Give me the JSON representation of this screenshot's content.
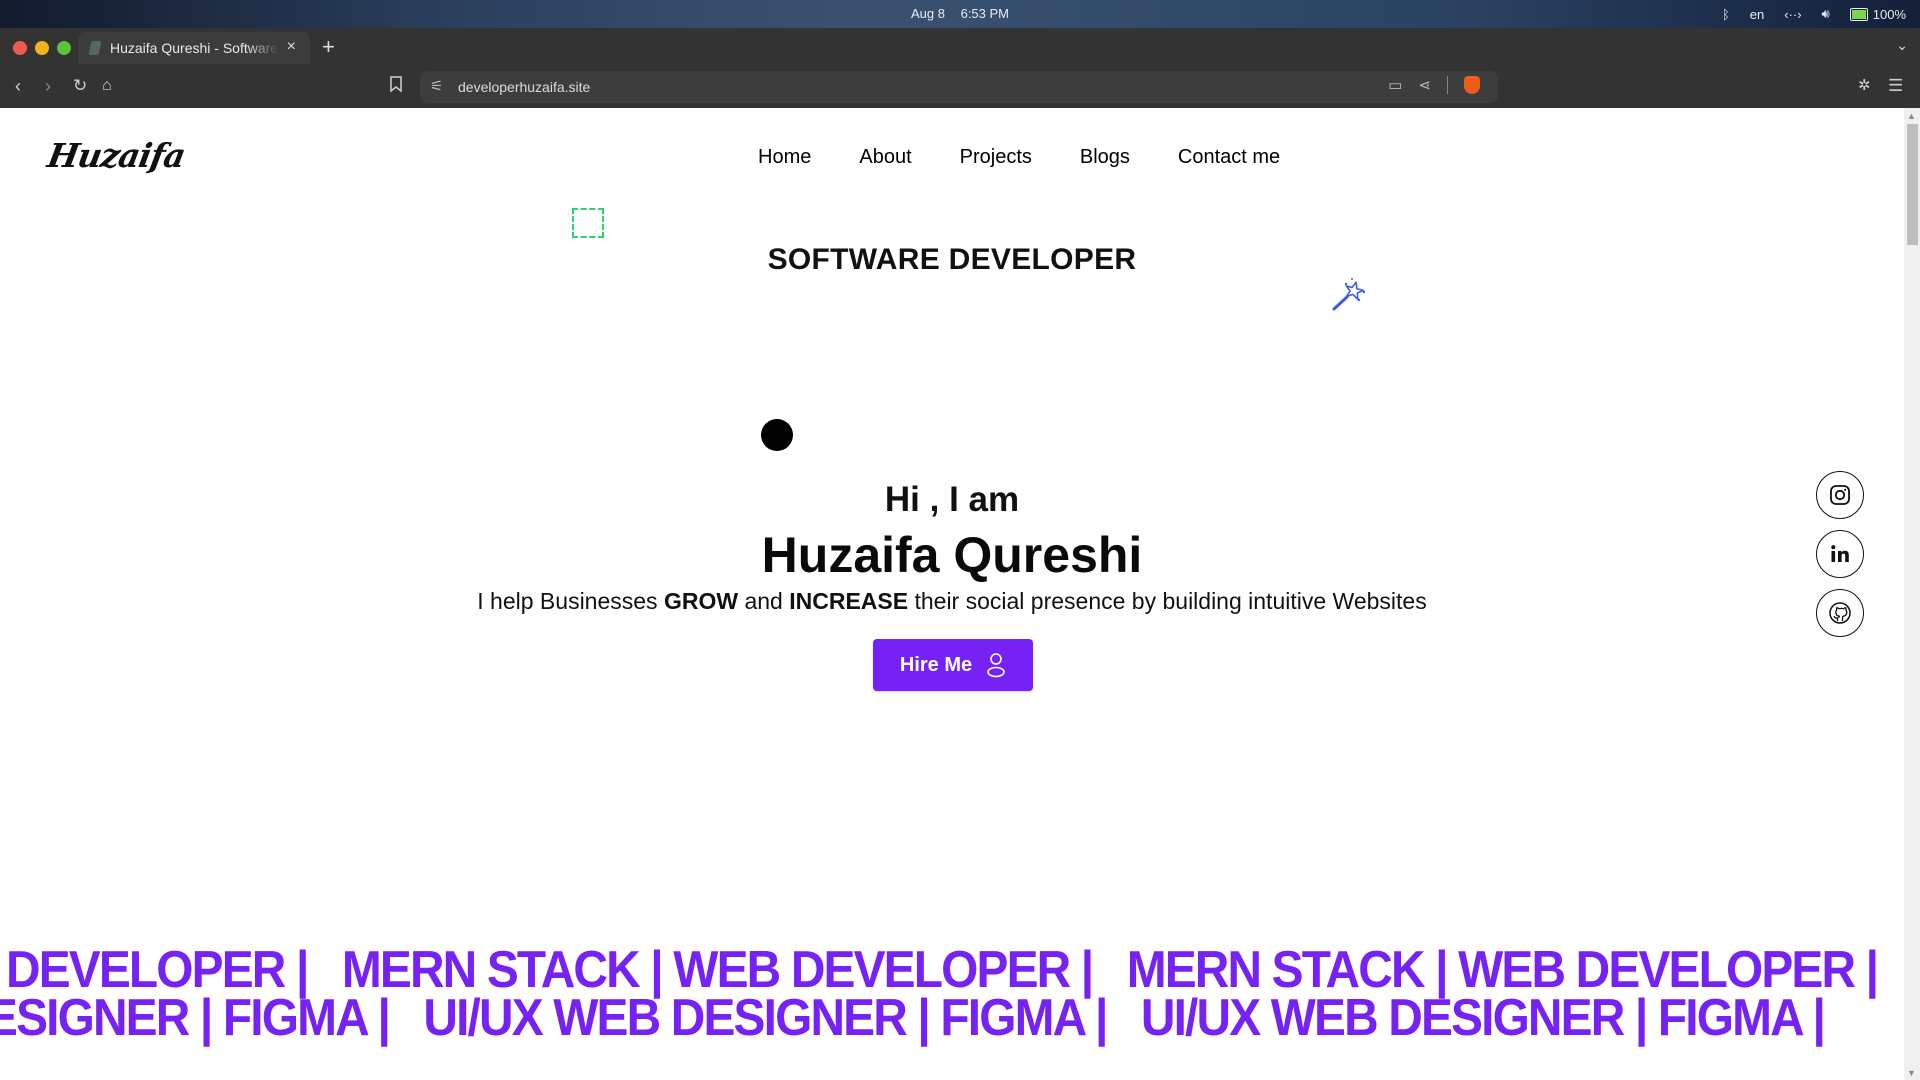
{
  "os_bar": {
    "date": "Aug 8",
    "time": "6:53 PM",
    "language": "en",
    "battery": "100%"
  },
  "browser": {
    "tab_title": "Huzaifa Qureshi - Software Developer",
    "url": "developerhuzaifa.site",
    "new_tab_label": "+",
    "tab_close_label": "×"
  },
  "site": {
    "logo": "Huzaifa",
    "nav": [
      "Home",
      "About",
      "Projects",
      "Blogs",
      "Contact me"
    ],
    "role": "SOFTWARE DEVELOPER",
    "greeting": "Hi , I am",
    "name": "Huzaifa Qureshi",
    "tagline": {
      "part1": "I help Businesses ",
      "bold1": "GROW",
      "part2": " and ",
      "bold2": "INCREASE",
      "part3": " their social presence by building intuitive Websites"
    },
    "hire_button": "Hire Me",
    "social": [
      "instagram",
      "linkedin",
      "github"
    ],
    "marquee_line1": "DEVELOPER |   MERN STACK | WEB DEVELOPER |   MERN STACK | WEB DEVELOPER |",
    "marquee_line2": "ESIGNER | FIGMA |   UI/UX WEB DESIGNER | FIGMA |   UI/UX WEB DESIGNER | FIGMA |"
  },
  "colors": {
    "accent": "#7622f5",
    "wand": "#3f5be0",
    "dashed_box": "#2fd36b"
  }
}
